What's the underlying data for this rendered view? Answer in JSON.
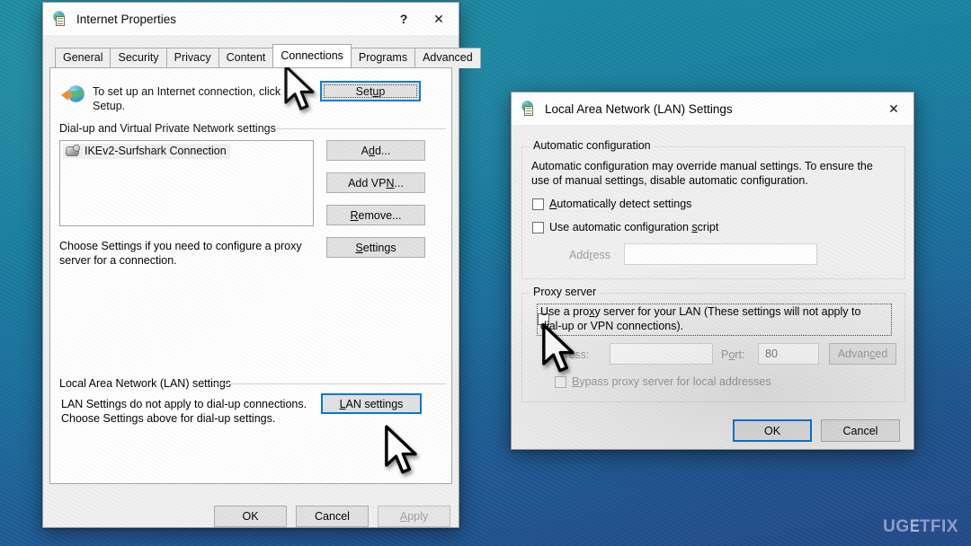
{
  "desktop": {
    "background_top_color": "#1d8ca3",
    "background_bottom_color": "#234a86",
    "watermark": {
      "part1": "UG",
      "part2": "E",
      "part3": "TFIX"
    }
  },
  "internet_properties": {
    "title": "Internet Properties",
    "icon": "internet-options-icon",
    "titlebar_buttons": {
      "help": "?",
      "close": "✕"
    },
    "tabs": [
      {
        "label": "General",
        "active": false
      },
      {
        "label": "Security",
        "active": false
      },
      {
        "label": "Privacy",
        "active": false
      },
      {
        "label": "Content",
        "active": false
      },
      {
        "label": "Connections",
        "active": true
      },
      {
        "label": "Programs",
        "active": false
      },
      {
        "label": "Advanced",
        "active": false
      }
    ],
    "setup_text_line1": "To set up an Internet connection, click",
    "setup_text_line2": "Setup.",
    "setup_button": "Setup",
    "dialup_group_label": "Dial-up and Virtual Private Network settings",
    "connections": [
      {
        "name": "IKEv2-Surfshark Connection",
        "icon": "network-connection-icon",
        "selected": true
      }
    ],
    "side_buttons": [
      {
        "label": "Add...",
        "disabled": false
      },
      {
        "label": "Add VPN...",
        "disabled": false
      },
      {
        "label": "Remove...",
        "disabled": false
      },
      {
        "label": "Settings",
        "disabled": false
      }
    ],
    "proxy_hint_line1": "Choose Settings if you need to configure a proxy",
    "proxy_hint_line2": "server for a connection.",
    "lan_group_label": "Local Area Network (LAN) settings",
    "lan_hint_line1": "LAN Settings do not apply to dial-up connections.",
    "lan_hint_line2": "Choose Settings above for dial-up settings.",
    "lan_settings_button": "LAN settings",
    "footer_buttons": [
      {
        "label": "OK",
        "disabled": false
      },
      {
        "label": "Cancel",
        "disabled": false
      },
      {
        "label": "Apply",
        "disabled": true
      }
    ]
  },
  "lan_settings": {
    "title": "Local Area Network (LAN) Settings",
    "icon": "internet-options-icon",
    "close_button": "✕",
    "automatic_configuration": {
      "group_label": "Automatic configuration",
      "description_line1": "Automatic configuration may override manual settings.  To ensure the",
      "description_line2": "use of manual settings, disable automatic configuration.",
      "auto_detect_label": "Automatically detect settings",
      "auto_detect_checked": false,
      "use_script_label": "Use automatic configuration script",
      "use_script_checked": false,
      "address_label": "Address",
      "address_value": "",
      "address_enabled": false
    },
    "proxy_server": {
      "group_label": "Proxy server",
      "use_proxy_label_line1": "Use a proxy server for your LAN (These settings will not apply to",
      "use_proxy_label_line2": "dial-up or VPN connections).",
      "use_proxy_checked": false,
      "address_label": "Address:",
      "address_value": "",
      "port_label": "Port:",
      "port_value": "80",
      "advanced_button": "Advanced",
      "bypass_label": "Bypass proxy server for local addresses",
      "bypass_checked": false
    },
    "footer_buttons": [
      {
        "label": "OK",
        "default": true
      },
      {
        "label": "Cancel",
        "default": false
      }
    ]
  }
}
